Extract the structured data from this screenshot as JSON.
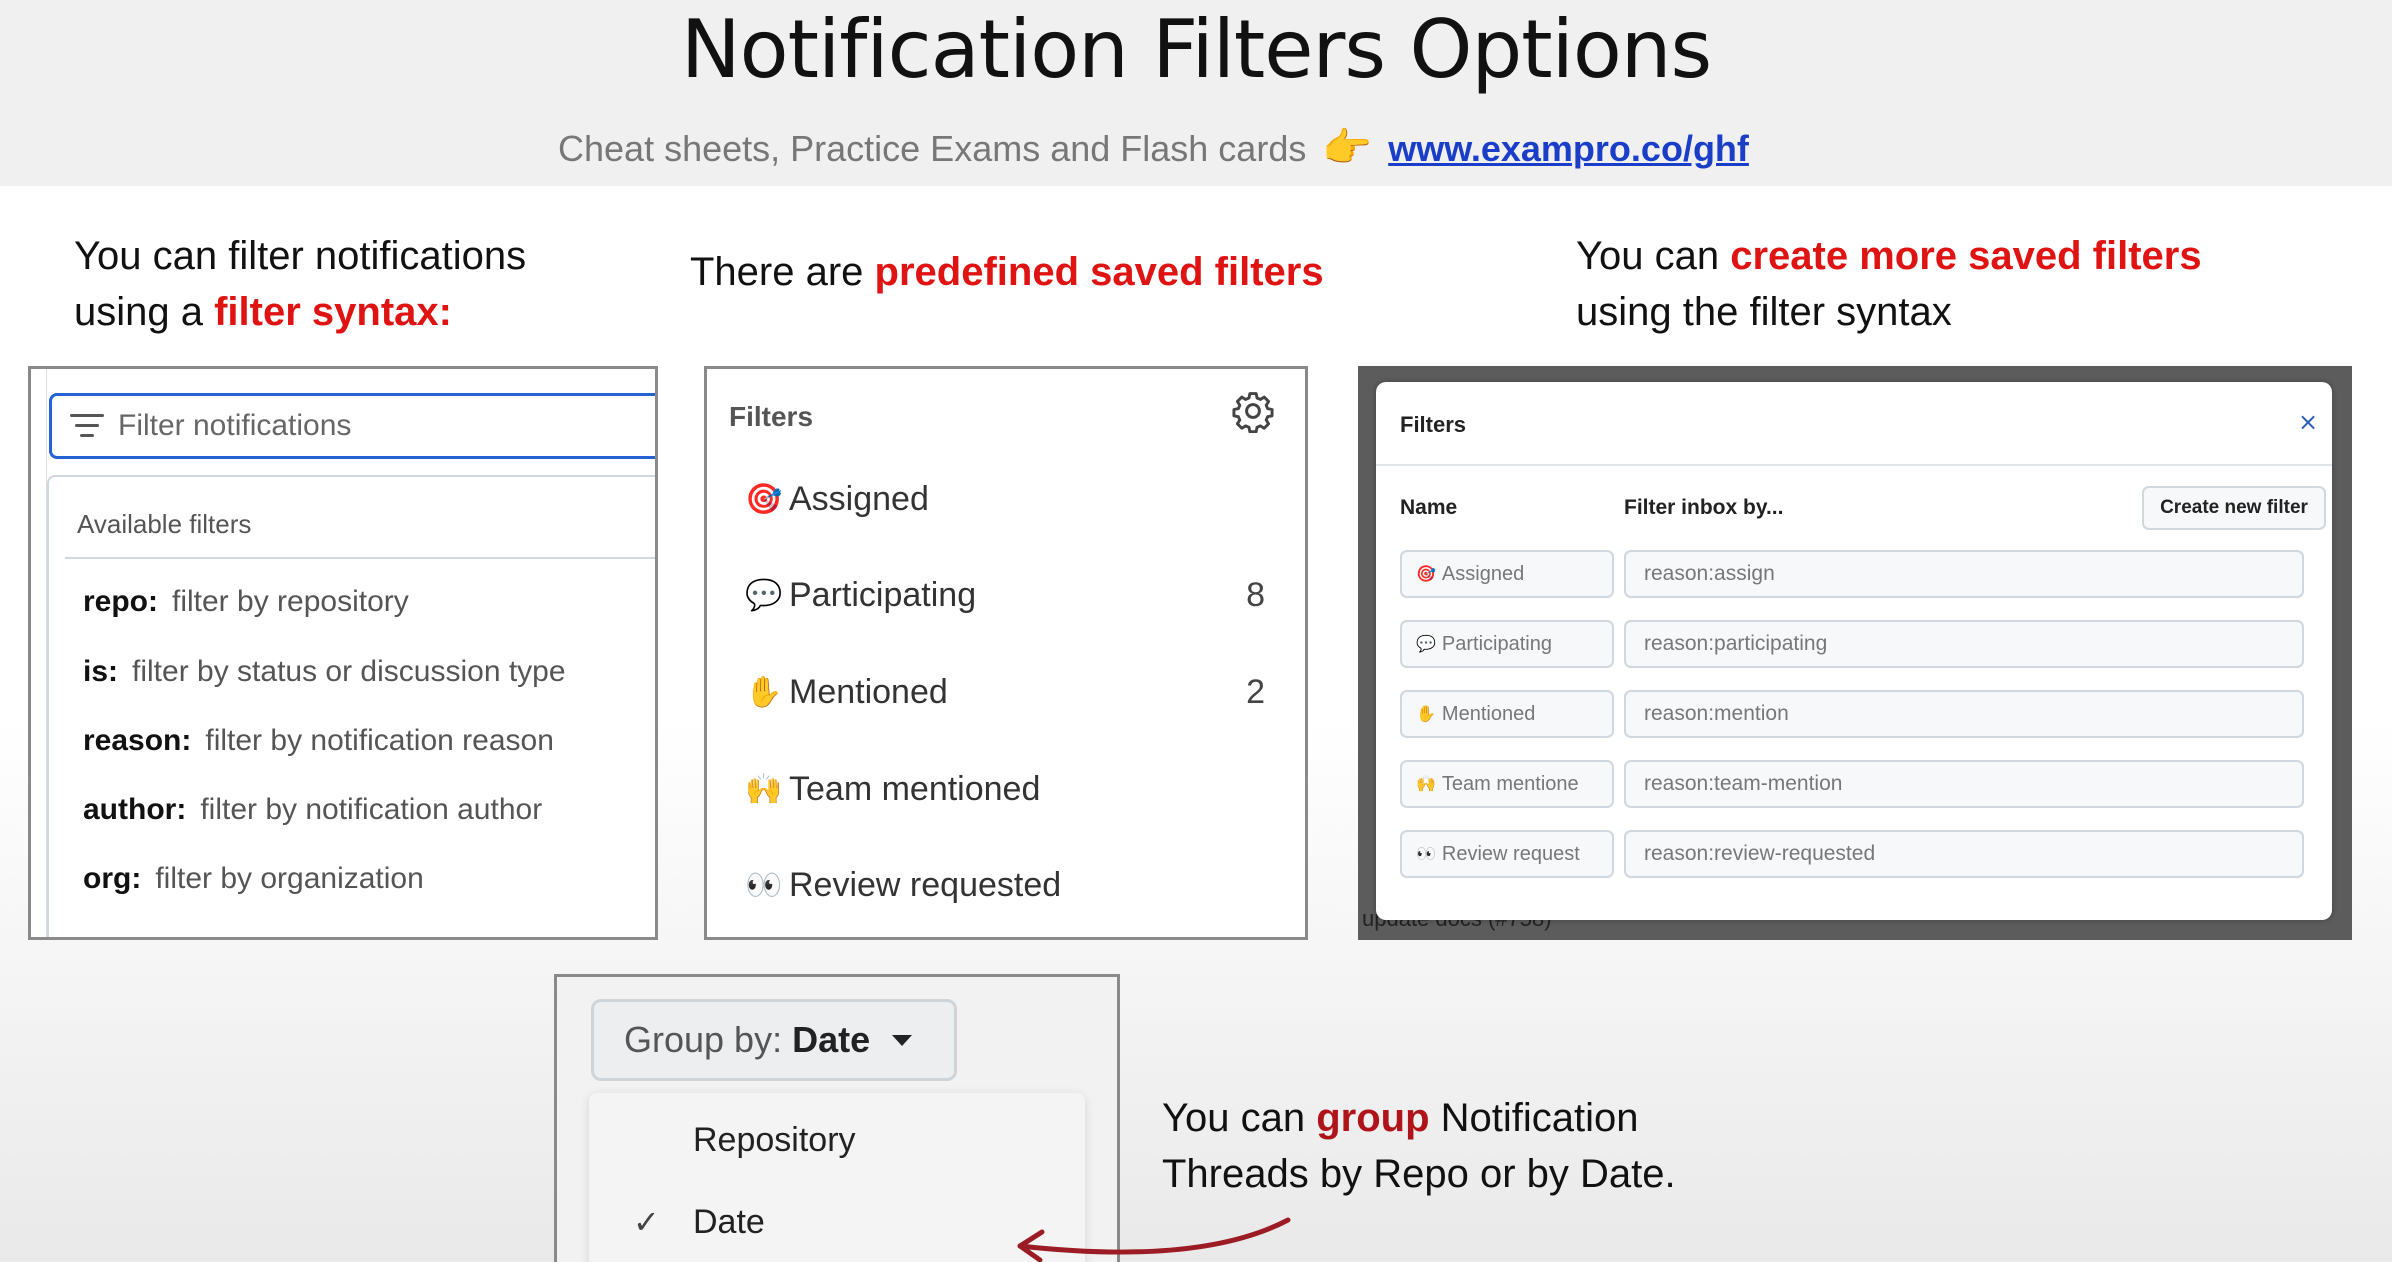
{
  "header": {
    "title": "Notification Filters Options",
    "subtitle": "Cheat sheets, Practice Exams and Flash cards",
    "link": "www.exampro.co/ghf"
  },
  "captions": {
    "c1_pre": "You can filter notifications",
    "c1_line2": "using a ",
    "c1_red": "filter syntax:",
    "c2_pre": "There are ",
    "c2_red": "predefined saved filters",
    "c3_pre": "You can ",
    "c3_red": "create more saved filters",
    "c3_line2": "using the filter syntax",
    "c4_pre": "You can ",
    "c4_red": "group",
    "c4_post": " Notification",
    "c4_line2": "Threads by Repo or by Date."
  },
  "filter_syntax": {
    "placeholder": "Filter notifications",
    "heading": "Available filters",
    "items": [
      {
        "key": "repo:",
        "desc": "filter by repository"
      },
      {
        "key": "is:",
        "desc": "filter by status or discussion type"
      },
      {
        "key": "reason:",
        "desc": "filter by notification reason"
      },
      {
        "key": "author:",
        "desc": "filter by notification author"
      },
      {
        "key": "org:",
        "desc": "filter by organization"
      }
    ]
  },
  "saved_filters": {
    "heading": "Filters",
    "items": [
      {
        "icon": "🎯",
        "label": "Assigned",
        "count": ""
      },
      {
        "icon": "💬",
        "label": "Participating",
        "count": "8"
      },
      {
        "icon": "✋",
        "label": "Mentioned",
        "count": "2"
      },
      {
        "icon": "🙌",
        "label": "Team mentioned",
        "count": ""
      },
      {
        "icon": "👀",
        "label": "Review requested",
        "count": ""
      }
    ]
  },
  "filters_modal": {
    "title": "Filters",
    "close": "×",
    "col_name": "Name",
    "col_filter": "Filter inbox by...",
    "create_button": "Create new filter",
    "rows": [
      {
        "icon": "🎯",
        "name": "Assigned",
        "query": "reason:assign"
      },
      {
        "icon": "💬",
        "name": "Participating",
        "query": "reason:participating"
      },
      {
        "icon": "✋",
        "name": "Mentioned",
        "query": "reason:mention"
      },
      {
        "icon": "🙌",
        "name": "Team mentione",
        "query": "reason:team-mention"
      },
      {
        "icon": "👀",
        "name": "Review request",
        "query": "reason:review-requested"
      }
    ],
    "background_snippet": "update docs (#758)"
  },
  "group_by": {
    "label": "Group by:",
    "value": "Date",
    "options": [
      "Repository",
      "Date"
    ],
    "checkmark": "✓"
  },
  "colors": {
    "accent_red": "#e01313",
    "link_blue": "#1a3ec8",
    "input_focus": "#2463d6"
  }
}
